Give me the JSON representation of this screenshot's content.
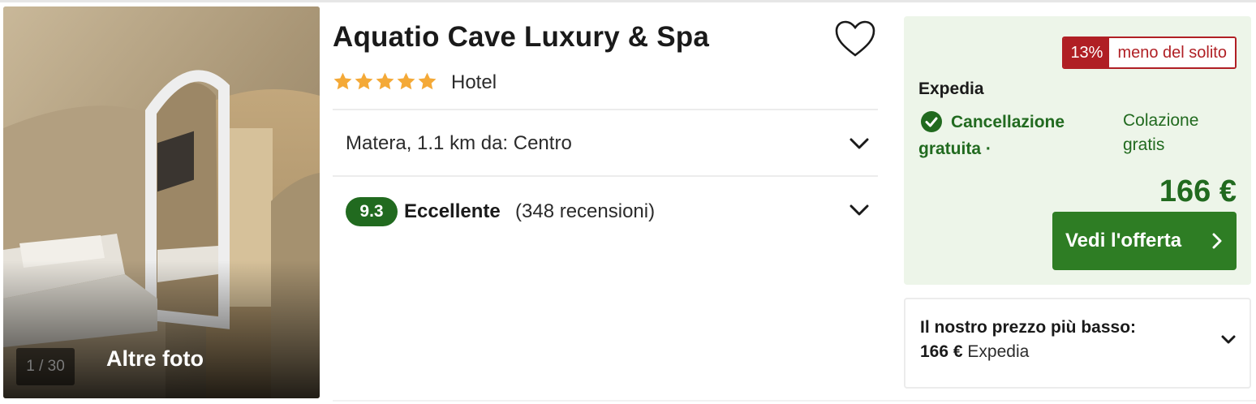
{
  "photo": {
    "counter": "1 / 30",
    "more_label": "Altre foto"
  },
  "hotel": {
    "name": "Aquatio Cave Luxury & Spa",
    "stars": 5,
    "type": "Hotel",
    "location": "Matera, 1.1 km da: Centro",
    "rating_score": "9.3",
    "rating_label": "Eccellente",
    "rating_count": "(348 recensioni)"
  },
  "deal": {
    "discount_pct": "13%",
    "discount_text": "meno del solito",
    "provider": "Expedia",
    "cancellation": "Cancellazione gratuita ·",
    "breakfast": "Colazione gratis",
    "price": "166 €",
    "cta_label": "Vedi l'offerta"
  },
  "lowest": {
    "label": "Il nostro prezzo più basso:",
    "price": "166 €",
    "provider": "Expedia"
  },
  "colors": {
    "green_dark": "#216a1f",
    "green_button": "#2e7d24",
    "deal_bg": "#edf5e9",
    "badge_red": "#b01f24",
    "star": "#f4a937"
  },
  "icons": {
    "favorite": "heart-outline-icon",
    "expand": "chevron-down-icon",
    "check": "check-circle-icon",
    "cta_arrow": "chevron-right-icon"
  }
}
